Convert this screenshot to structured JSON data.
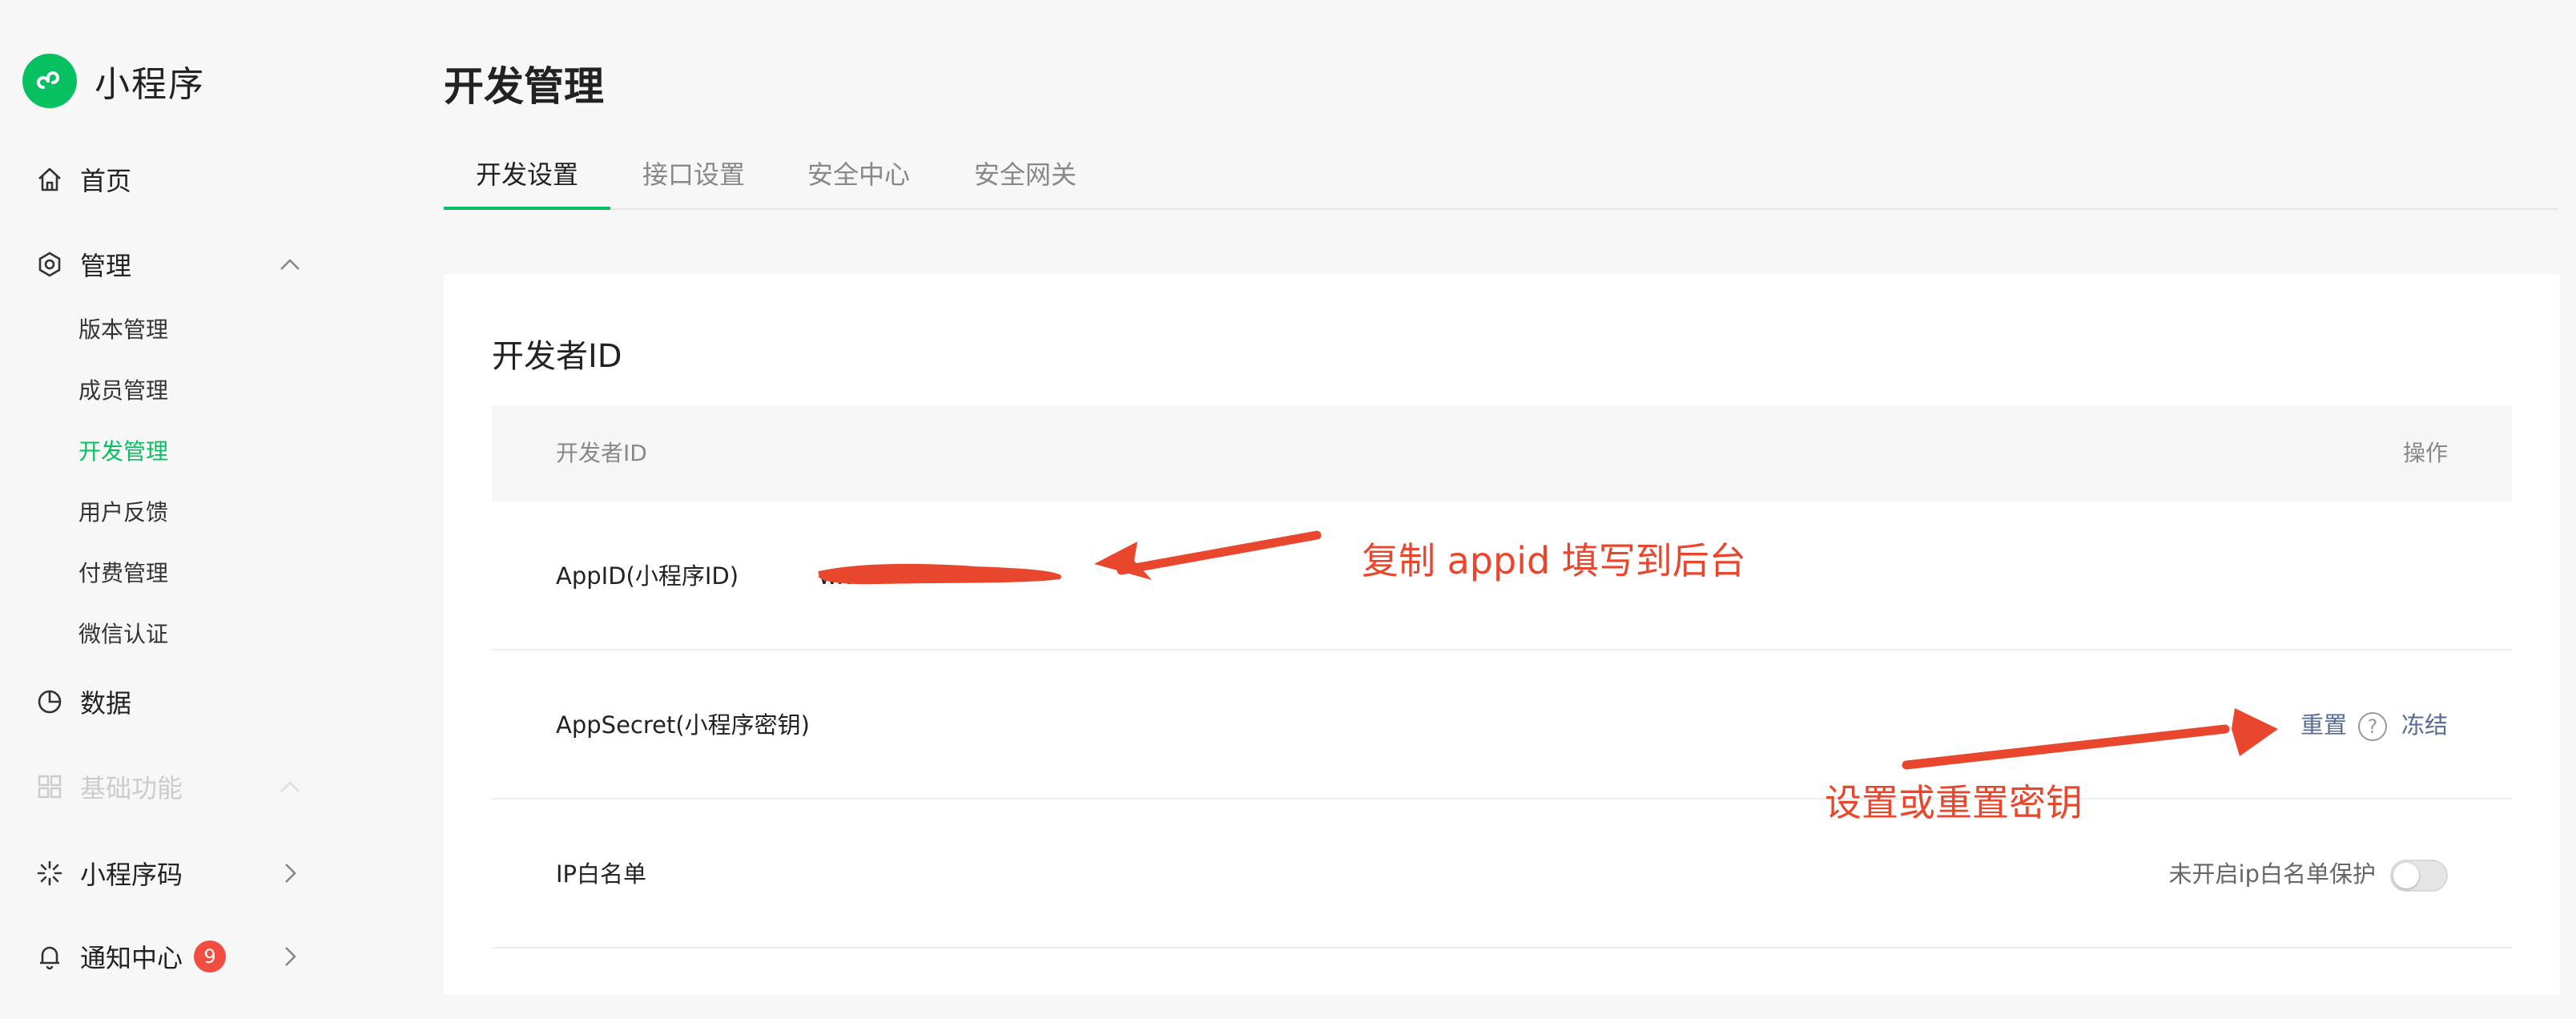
{
  "app": {
    "name": "小程序"
  },
  "sidebar": {
    "home": "首页",
    "manage": "管理",
    "manage_items": [
      "版本管理",
      "成员管理",
      "开发管理",
      "用户反馈",
      "付费管理",
      "微信认证"
    ],
    "data": "数据",
    "basic": "基础功能",
    "qrcode": "小程序码",
    "notify": "通知中心",
    "notify_count": "9"
  },
  "page": {
    "title": "开发管理",
    "tabs": [
      "开发设置",
      "接口设置",
      "安全中心",
      "安全网关"
    ],
    "active_tab": "开发设置"
  },
  "developer_id": {
    "section_title": "开发者ID",
    "columns": [
      "开发者ID",
      "操作"
    ],
    "rows": [
      {
        "label": "AppID(小程序ID)",
        "value": "wx"
      },
      {
        "label": "AppSecret(小程序密钥)",
        "actions": [
          "重置",
          "冻结"
        ],
        "help": "?"
      },
      {
        "label": "IP白名单",
        "status": "未开启ip白名单保护",
        "toggle": false
      }
    ]
  },
  "annotations": {
    "copy_appid": "复制 appid 填写到后台",
    "reset_secret": "设置或重置密钥"
  },
  "colors": {
    "brand": "#07c160",
    "link": "#576b95",
    "badge": "#f04d43",
    "annotation": "#e8472e"
  }
}
